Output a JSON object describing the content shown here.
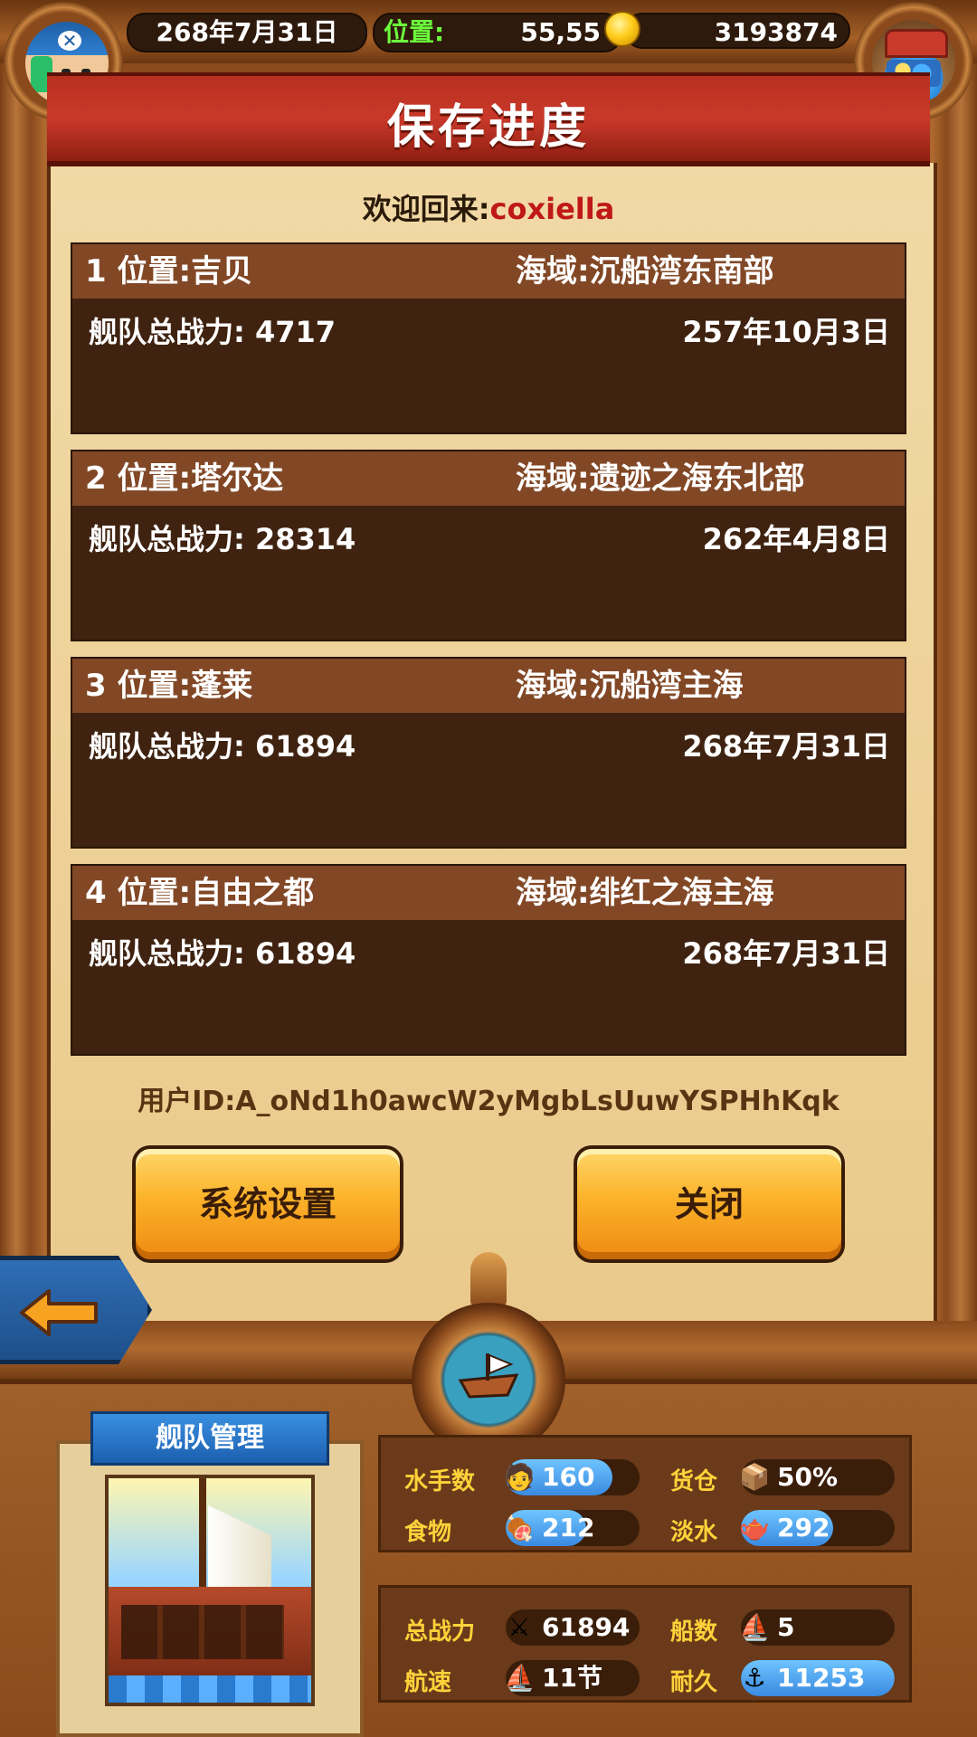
{
  "hud": {
    "date": "268年7月31日",
    "position_label": "位置:",
    "position_value": "55,55",
    "gold": "3193874"
  },
  "title": "保存进度",
  "welcome": {
    "prefix": "欢迎回来:",
    "username": "coxiella"
  },
  "slots": [
    {
      "location": "1 位置:吉贝",
      "sea": "海域:沉船湾东南部",
      "power": "舰队总战力: 4717",
      "date": "257年10月3日"
    },
    {
      "location": "2 位置:塔尔达",
      "sea": "海域:遗迹之海东北部",
      "power": "舰队总战力: 28314",
      "date": "262年4月8日"
    },
    {
      "location": "3 位置:蓬莱",
      "sea": "海域:沉船湾主海",
      "power": "舰队总战力: 61894",
      "date": "268年7月31日"
    },
    {
      "location": "4 位置:自由之都",
      "sea": "海域:绯红之海主海",
      "power": "舰队总战力: 61894",
      "date": "268年7月31日"
    }
  ],
  "user_id": "用户ID:A_oNd1h0awcW2yMgbLsUuwYSPHhKqk",
  "buttons": {
    "settings": "系统设置",
    "close": "关闭"
  },
  "fleet": {
    "title": "舰队管理",
    "stats": {
      "sailors": {
        "label": "水手数",
        "value": "160",
        "icon": "sailor-icon",
        "fill": 0.8
      },
      "cargo": {
        "label": "货仓",
        "value": "50%",
        "icon": "crate-icon",
        "fill": 0.0
      },
      "food": {
        "label": "食物",
        "value": "212",
        "icon": "meat-icon",
        "fill": 0.6
      },
      "water": {
        "label": "淡水",
        "value": "292",
        "icon": "water-jug-icon",
        "fill": 0.6
      },
      "power": {
        "label": "总战力",
        "value": "61894",
        "icon": "crossed-swords-icon",
        "fill": 0.0
      },
      "ships": {
        "label": "船数",
        "value": "5",
        "icon": "ship-icon",
        "fill": 0.0
      },
      "speed": {
        "label": "航速",
        "value": "11节",
        "icon": "sailboat-icon",
        "fill": 0.0
      },
      "durability": {
        "label": "耐久",
        "value": "11253",
        "icon": "anchor-icon",
        "fill": 1.0
      }
    }
  },
  "colors": {
    "banner_red": "#c9392a",
    "slot_header": "#824826",
    "slot_body": "#3f2310",
    "welcome_name": "#c01818",
    "position_label_green": "#6cff3c",
    "stat_label_gold": "#ffd23a",
    "stat_bar_blue": "#3a8ae0",
    "button_orange": "#fbb22a"
  }
}
